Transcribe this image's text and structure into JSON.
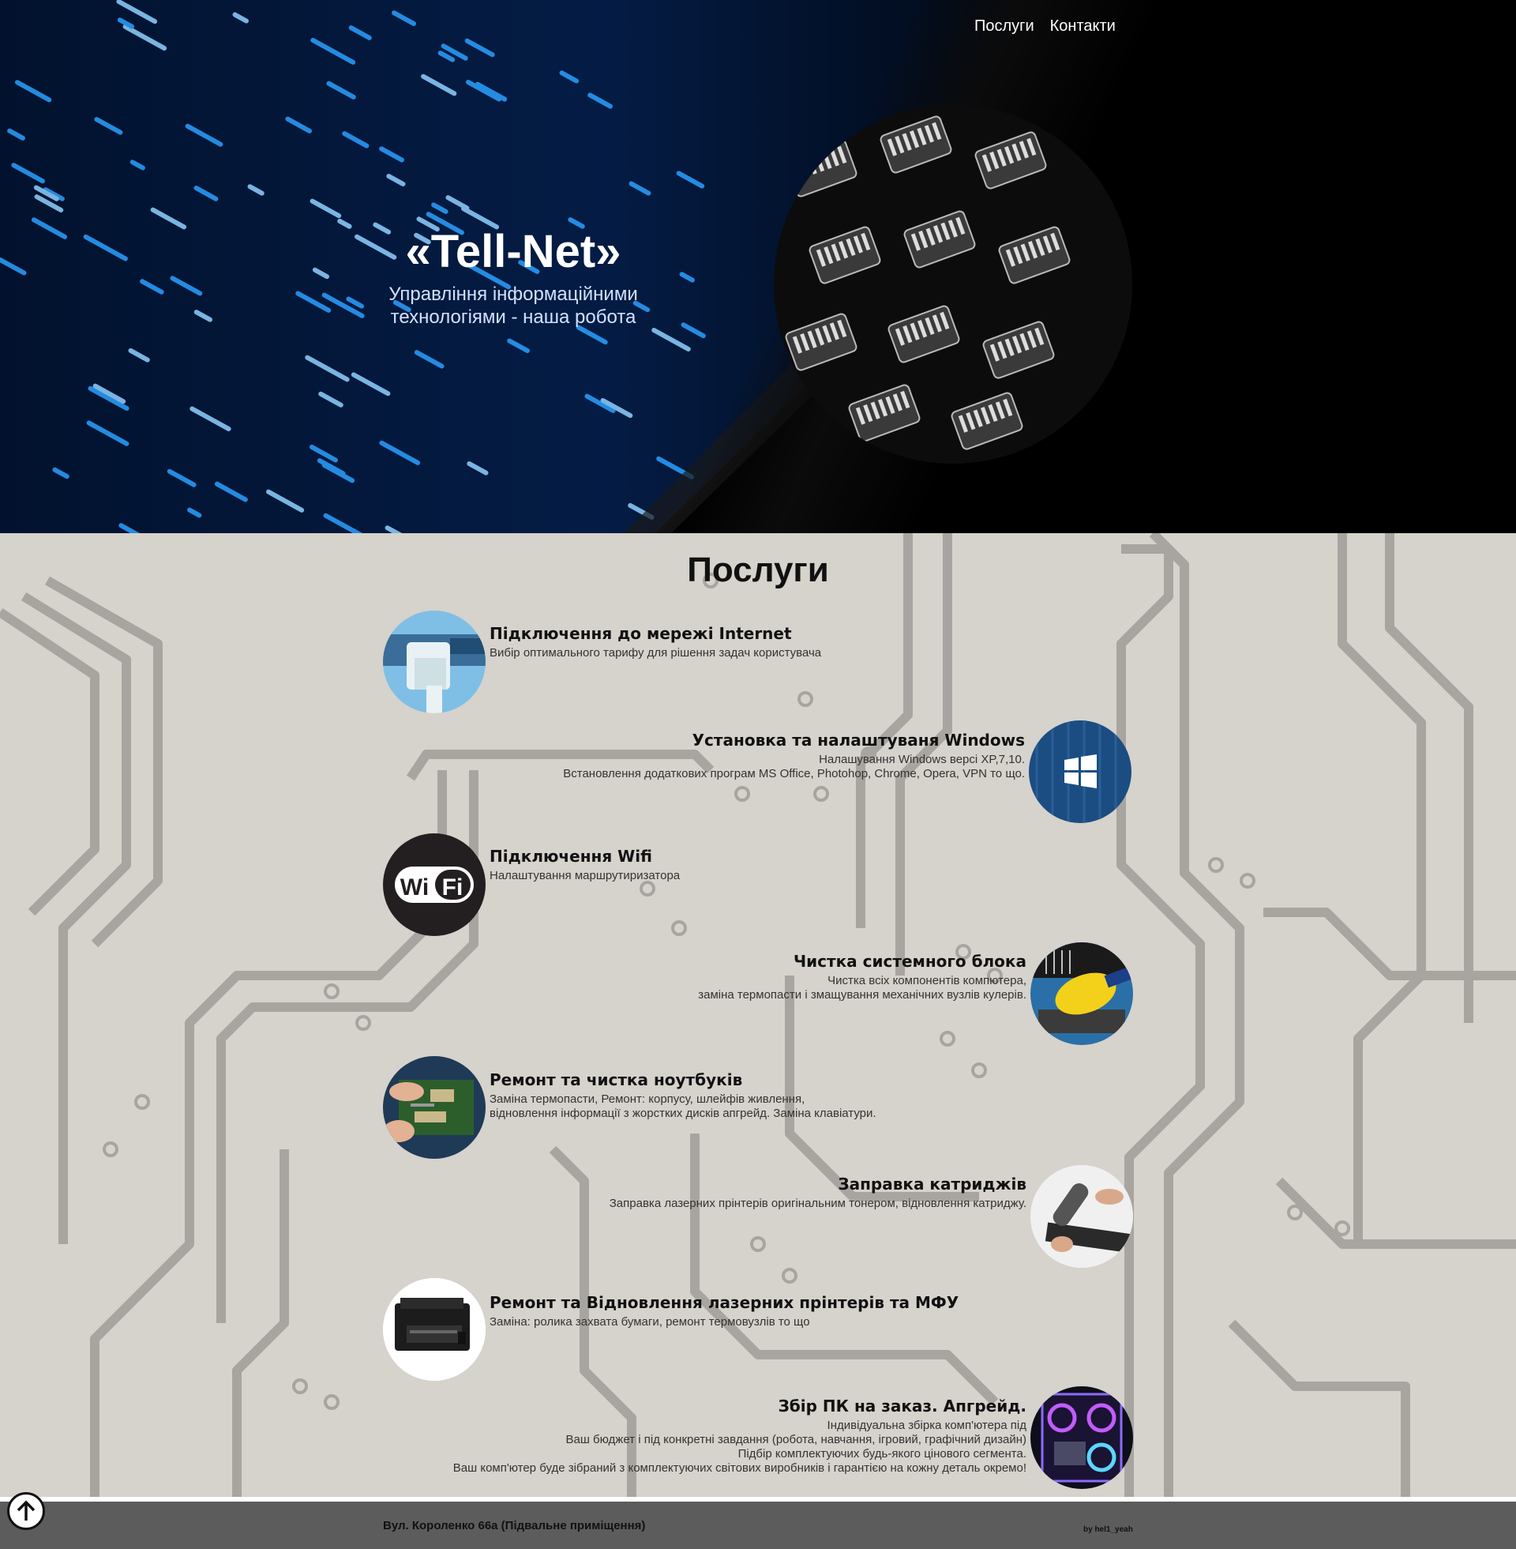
{
  "nav": {
    "services": "Послуги",
    "contacts": "Контакти"
  },
  "hero": {
    "title": "«Tell-Net»",
    "subtitle": "Управління інформаційними технологіями - наша робота"
  },
  "services": {
    "title": "Послуги",
    "items": [
      {
        "title": "Підключення до мережі Internet",
        "desc": "Вибір оптимального тарифу для рішення задач користувача",
        "icon": "ethernet-icon"
      },
      {
        "title": "Установка та налаштуваня Windows",
        "desc": "Налашування Windows версі XP,7,10.\nВстановлення додаткових програм MS Office, Photohop, Chrome, Opera, VPN то що.",
        "icon": "windows-icon"
      },
      {
        "title": "Підключення Wifi",
        "desc": "Налаштування маршрутиризатора",
        "icon": "wifi-icon",
        "icon_text": "WiFi"
      },
      {
        "title": "Чистка системного блока",
        "desc": "Чистка всіх компонентів компютера,\nзаміна термопасти і змащування механічних вузлів кулерів.",
        "icon": "cleaning-brush-icon"
      },
      {
        "title": "Ремонт та чистка ноутбуків",
        "desc": "Заміна термопасти, Ремонт: корпусу, шлейфів живлення,\nвідновлення інформації з жорстких дисків апгрейд. Заміна клавіатури.",
        "icon": "laptop-repair-icon"
      },
      {
        "title": "Заправка катриджів",
        "desc": "Заправка лазерних прінтерів оригінальним тонером, відновлення катриджу.",
        "icon": "cartridge-icon"
      },
      {
        "title": "Ремонт та Відновлення лазерних прінтерів та МФУ",
        "desc": "Заміна: ролика захвата бумаги, ремонт термовузлів то що",
        "icon": "printer-icon"
      },
      {
        "title": "Збір ПК на заказ. Апгрейд.",
        "desc": "Індивідуальна збірка комп'ютера під\nВаш бюджет і під конкретні завдання (робота, навчання, ігровий, графічний дизайн)\nПідбір комплектуючих будь-якого цінового сегмента.\nВаш комп'ютер буде зібраний з комплектуючих світових виробників і гарантією на кожну деталь окремо!",
        "icon": "gaming-pc-icon"
      }
    ]
  },
  "footer": {
    "address": "Вул. Короленко 66а (Підвальне приміщення)",
    "credit": "by hel1_yeah"
  },
  "colors": {
    "hero_bg": "#000000",
    "services_bg": "#d6d2cc",
    "circuit": "#a8a5a1",
    "footer_bg": "#5c5c5c",
    "accent_blue": "#1e8fff"
  }
}
